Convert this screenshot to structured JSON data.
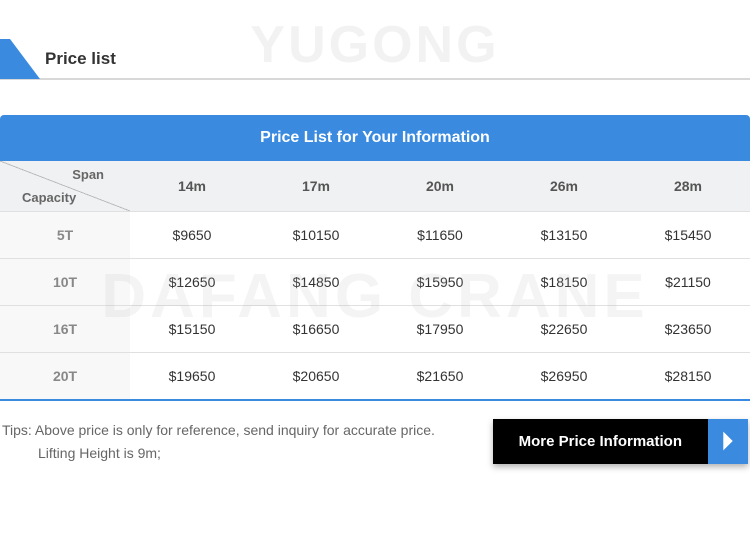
{
  "section_title": "Price list",
  "table": {
    "title": "Price List for Your Information",
    "corner": {
      "span": "Span",
      "capacity": "Capacity"
    },
    "columns": [
      "14m",
      "17m",
      "20m",
      "26m",
      "28m"
    ],
    "rows": [
      {
        "capacity": "5T",
        "values": [
          "$9650",
          "$10150",
          "$11650",
          "$13150",
          "$15450"
        ]
      },
      {
        "capacity": "10T",
        "values": [
          "$12650",
          "$14850",
          "$15950",
          "$18150",
          "$21150"
        ]
      },
      {
        "capacity": "16T",
        "values": [
          "$15150",
          "$16650",
          "$17950",
          "$22650",
          "$23650"
        ]
      },
      {
        "capacity": "20T",
        "values": [
          "$19650",
          "$20650",
          "$21650",
          "$26950",
          "$28150"
        ]
      }
    ]
  },
  "tips": {
    "line1": "Tips: Above price is only for reference, send inquiry for accurate price.",
    "line2": "Lifting Height is 9m;"
  },
  "more_button": "More Price Information",
  "watermark": "DAFANG CRANE",
  "watermark_top": "YUGONG",
  "chart_data": {
    "type": "table",
    "title": "Price List for Your Information",
    "xlabel": "Span",
    "ylabel": "Capacity",
    "columns": [
      "14m",
      "17m",
      "20m",
      "26m",
      "28m"
    ],
    "rows": [
      "5T",
      "10T",
      "16T",
      "20T"
    ],
    "values": [
      [
        9650,
        10150,
        11650,
        13150,
        15450
      ],
      [
        12650,
        14850,
        15950,
        18150,
        21150
      ],
      [
        15150,
        16650,
        17950,
        22650,
        23650
      ],
      [
        19650,
        20650,
        21650,
        26950,
        28150
      ]
    ],
    "unit": "USD"
  }
}
